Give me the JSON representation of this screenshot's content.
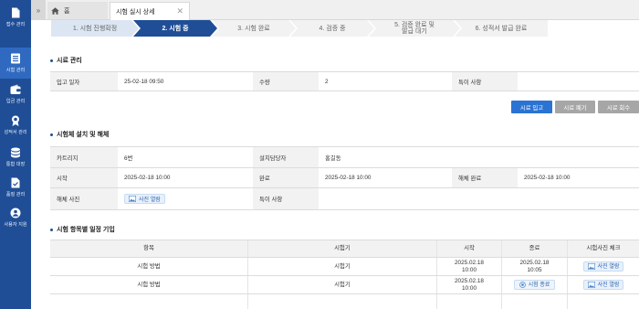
{
  "sidebar": {
    "items": [
      {
        "label": "접수 관리",
        "icon": "document-icon"
      },
      {
        "label": "시험 관리",
        "icon": "list-icon"
      },
      {
        "label": "입금 관리",
        "icon": "wallet-icon"
      },
      {
        "label": "성적서 관리",
        "icon": "ribbon-icon"
      },
      {
        "label": "통합 대장",
        "icon": "database-icon"
      },
      {
        "label": "품질 관리",
        "icon": "file-check-icon"
      },
      {
        "label": "사용자 지원",
        "icon": "user-icon"
      }
    ],
    "active_index": 1
  },
  "tabbar": {
    "collapse": "»",
    "home_label": "홈",
    "active_tab_label": "시험 실시 상세",
    "close_glyph": "✕"
  },
  "stepper": {
    "steps": [
      "1. 시험 진행확정",
      "2. 시험 중",
      "3. 시험 완료",
      "4. 검증 중",
      "5. 검증 완료 및\n발급 대기",
      "6. 성적서 발급 완료"
    ],
    "current_index": 1
  },
  "sample": {
    "title": "시료 관리",
    "receipt_date_label": "입고 일자",
    "receipt_date": "25-02-18   09:50",
    "quantity_label": "수량",
    "quantity": "2",
    "remarks_label": "특이 사항",
    "remarks": "",
    "buttons": {
      "receive": "시료 입고",
      "dispose": "시료 폐기",
      "retrieve": "시료 회수"
    }
  },
  "fixture": {
    "title": "시험체 설치 및 해체",
    "cartridge_label": "카트리지",
    "cartridge": "6번",
    "installer_label": "설치담당자",
    "installer": "홍길동",
    "start_label": "시작",
    "start": "2025-02-18 10:00",
    "complete_label": "완료",
    "complete": "2025-02-18 10:00",
    "dismantle_label": "해체 완료",
    "dismantle": "2025-02-18 10:00",
    "dismantle_photo_label": "해체 사진",
    "photo_view": "사진 열람",
    "remarks_label": "특이 사항",
    "remarks": ""
  },
  "schedule": {
    "title": "시험 항목별 일정 기입",
    "headers": [
      "항목",
      "시험기",
      "시작",
      "종료",
      "시험사진 체크"
    ],
    "rows": [
      {
        "item": "시험 방법",
        "machine": "시험기",
        "start": "2025.02.18\n10:00",
        "end": "2025.02.18\n10:05",
        "end_is_button": false,
        "photo": "사진 열람"
      },
      {
        "item": "시험 방법",
        "machine": "시험기",
        "start": "2025.02.18\n10:00",
        "end": "시험 종료",
        "end_is_button": true,
        "photo": "사진 열람"
      }
    ]
  },
  "colors": {
    "sidebar": "#1f4e96",
    "step_active": "#1f4e96",
    "primary_button": "#2b73d2",
    "gray_button": "#a6a6a6"
  }
}
